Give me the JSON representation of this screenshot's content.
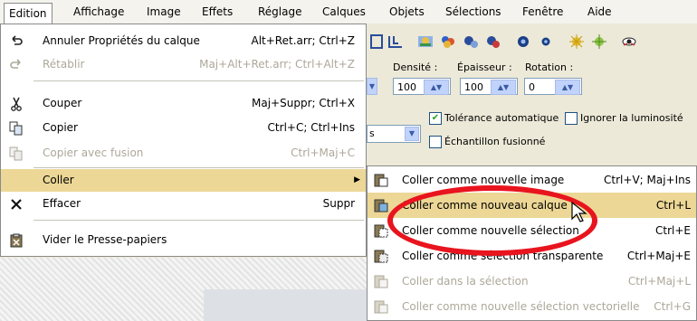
{
  "menubar": {
    "items": [
      {
        "label": "Edition",
        "active": true
      },
      {
        "label": "Affichage"
      },
      {
        "label": "Image"
      },
      {
        "label": "Effets"
      },
      {
        "label": "Réglage"
      },
      {
        "label": "Calques"
      },
      {
        "label": "Objets"
      },
      {
        "label": "Sélections"
      },
      {
        "label": "Fenêtre"
      },
      {
        "label": "Aide"
      }
    ]
  },
  "options": {
    "densite_label": "Densité :",
    "densite_value": "100",
    "epaisseur_label": "Épaisseur :",
    "epaisseur_value": "100",
    "rotation_label": "Rotation :",
    "rotation_value": "0",
    "tolerance_label": "Tolérance automatique",
    "tolerance_checked": true,
    "ignorer_label": "Ignorer la luminosité",
    "ignorer_checked": false,
    "echantillon_label": "Échantillon fusionné",
    "echantillon_checked": false,
    "left_fragment": "s"
  },
  "edit_menu": {
    "items": [
      {
        "label": "Annuler Propriétés du calque",
        "shortcut": "Alt+Ret.arr; Ctrl+Z",
        "icon": "undo-icon",
        "disabled": false
      },
      {
        "label": "Rétablir",
        "shortcut": "Maj+Alt+Ret.arr; Ctrl+Alt+Z",
        "icon": "redo-icon",
        "disabled": true
      },
      {
        "label": "Couper",
        "shortcut": "Maj+Suppr; Ctrl+X",
        "icon": "scissors-icon",
        "disabled": false
      },
      {
        "label": "Copier",
        "shortcut": "Ctrl+C; Ctrl+Ins",
        "icon": "copy-icon",
        "disabled": false
      },
      {
        "label": "Copier avec fusion",
        "shortcut": "Ctrl+Maj+C",
        "icon": "copy-merged-icon",
        "disabled": true
      },
      {
        "label": "Coller",
        "shortcut": "",
        "icon": "",
        "disabled": false,
        "highlighted": true,
        "submenu": true
      },
      {
        "label": "Effacer",
        "shortcut": "Suppr",
        "icon": "clear-x-icon",
        "disabled": false
      },
      {
        "label": "Vider le Presse-papiers",
        "shortcut": "",
        "icon": "empty-clipboard-icon",
        "disabled": false
      }
    ]
  },
  "paste_submenu": {
    "items": [
      {
        "label": "Coller comme nouvelle image",
        "shortcut": "Ctrl+V; Maj+Ins",
        "disabled": false
      },
      {
        "label": "Coller comme nouveau calque",
        "shortcut": "Ctrl+L",
        "disabled": false,
        "highlighted": true
      },
      {
        "label": "Coller comme nouvelle sélection",
        "shortcut": "Ctrl+E",
        "disabled": false
      },
      {
        "label": "Coller comme sélection transparente",
        "shortcut": "Ctrl+Maj+E",
        "disabled": false
      },
      {
        "label": "Coller dans la sélection",
        "shortcut": "Ctrl+Maj+L",
        "disabled": true
      },
      {
        "label": "Coller comme nouvelle sélection vectorielle",
        "shortcut": "Ctrl+G",
        "disabled": true
      }
    ]
  },
  "colors": {
    "menu_highlight": "#ecd796",
    "annotation_oval": "#e8141e",
    "menubar_bg": "#f4f3ee",
    "toolbar_bg": "#ece9d8"
  }
}
